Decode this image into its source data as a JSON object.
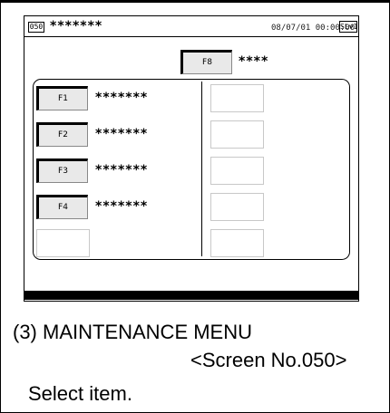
{
  "screen": {
    "screen_number": "050",
    "title": "*******",
    "datetime": "08/07/01 00:00:00",
    "security_level": "SLv1"
  },
  "top_key": {
    "label": "F8",
    "text": "****"
  },
  "left_keys": [
    {
      "label": "F1",
      "text": "*******"
    },
    {
      "label": "F2",
      "text": "*******"
    },
    {
      "label": "F3",
      "text": "*******"
    },
    {
      "label": "F4",
      "text": "*******"
    }
  ],
  "caption": {
    "title": "(3) MAINTENANCE MENU",
    "screen": "<Screen No.050>",
    "instruction": "Select item."
  }
}
